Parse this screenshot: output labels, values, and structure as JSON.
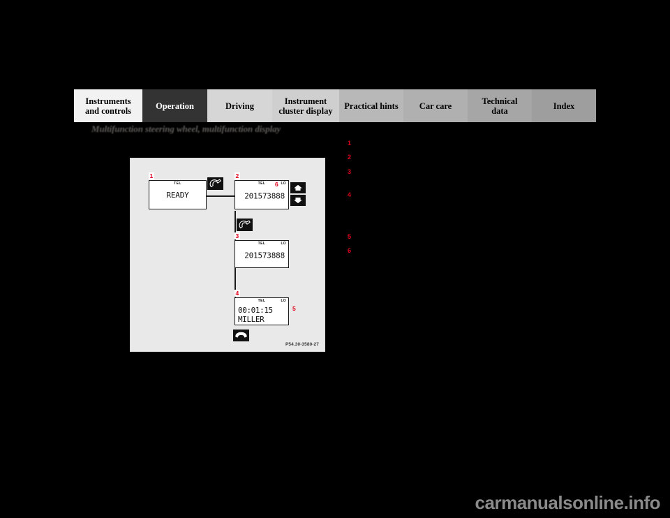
{
  "tabs": [
    {
      "label": "Instruments\nand controls",
      "active": false
    },
    {
      "label": "Operation",
      "active": true
    },
    {
      "label": "Driving",
      "active": false
    },
    {
      "label": "Instrument\ncluster display",
      "active": false
    },
    {
      "label": "Practical hints",
      "active": false
    },
    {
      "label": "Car care",
      "active": false
    },
    {
      "label": "Technical\ndata",
      "active": false
    },
    {
      "label": "Index",
      "active": false
    }
  ],
  "section": {
    "title": "Multifunction steering wheel, multifunction display"
  },
  "figure": {
    "code": "P54.30-3580-27",
    "background_color": "#e9e9e9",
    "displays": [
      {
        "callout": "1",
        "header_left": "TEL",
        "header_right": "",
        "text": "READY",
        "align": "center"
      },
      {
        "callout": "2",
        "header_left": "TEL",
        "header_right": "LO",
        "inline_callout": "6",
        "text": "201573888",
        "align": "right"
      },
      {
        "callout": "3",
        "header_left": "TEL",
        "header_right": "LO",
        "text": "201573888",
        "align": "right"
      },
      {
        "callout": "4",
        "header_left": "TEL",
        "header_right": "LO",
        "inline_callout": "5",
        "line1": "00:01:15",
        "line2": "MILLER",
        "align": "left"
      }
    ],
    "icons": [
      {
        "name": "phone-offhook-icon",
        "position": "between-box1-box2"
      },
      {
        "name": "phone-offhook-icon",
        "position": "between-box2-box3"
      },
      {
        "name": "arrow-up-icon",
        "position": "right-of-box2"
      },
      {
        "name": "arrow-down-icon",
        "position": "right-of-box2"
      },
      {
        "name": "phone-onhook-icon",
        "position": "below-box4"
      }
    ]
  },
  "legend": [
    {
      "num": "1",
      "text": ""
    },
    {
      "num": "2",
      "text": ""
    },
    {
      "num": "3",
      "text": ""
    },
    {
      "num": "4",
      "text": ""
    },
    {
      "num": "5",
      "text": ""
    },
    {
      "num": "6",
      "text": ""
    }
  ],
  "watermark": "carmanualsonline.info",
  "colors": {
    "page_background": "#000000",
    "callout_red": "#e1001a",
    "active_tab": "#333333",
    "figure_background": "#e9e9e9"
  }
}
